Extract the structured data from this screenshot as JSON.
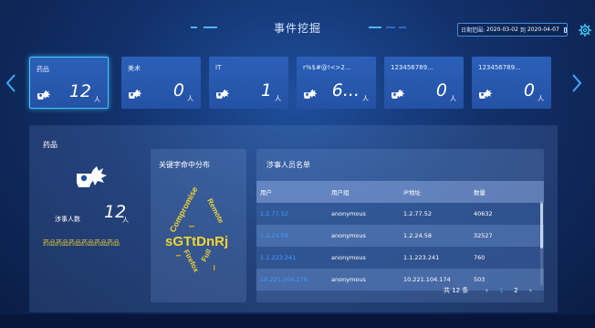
{
  "header": {
    "title": "事件挖掘",
    "date_label": "日期范围:",
    "date_start": "2020-03-02",
    "date_sep": "到",
    "date_end": "2020-04-07"
  },
  "cards": [
    {
      "label": "药品",
      "count": "12",
      "unit": "人"
    },
    {
      "label": "美术",
      "count": "0",
      "unit": "人"
    },
    {
      "label": "IT",
      "count": "1",
      "unit": "人"
    },
    {
      "label": "r%$#@!<>2...",
      "count": "6...",
      "unit": "人"
    },
    {
      "label": "123456789...",
      "count": "0",
      "unit": "人"
    },
    {
      "label": "123456789...",
      "count": "0",
      "unit": "人"
    }
  ],
  "detail": {
    "title": "药品",
    "people_label": "涉事人数",
    "people_count": "12",
    "people_unit": "人",
    "keyword_text": "药品药品药品药品药品药品"
  },
  "keywords": {
    "title": "关键字命中分布",
    "words": [
      {
        "text": "sGTtDnRj"
      },
      {
        "text": "Compromise"
      },
      {
        "text": "Remote"
      },
      {
        "text": "Firefox"
      },
      {
        "text": "Full"
      }
    ],
    "colors": {
      "primary": "#f2d434",
      "secondary": "#e6c52c"
    }
  },
  "table": {
    "title": "涉事人员名单",
    "columns": [
      "用户",
      "用户组",
      "IP地址",
      "数量"
    ],
    "rows": [
      [
        "1.2.77.52",
        "anonymous",
        "1.2.77.52",
        "40632"
      ],
      [
        "1.2.24.58",
        "anonymous",
        "1.2.24.58",
        "32527"
      ],
      [
        "1.1.223.241",
        "anonymous",
        "1.1.223.241",
        "760"
      ],
      [
        "10.221.104.174",
        "anonymous",
        "10.221.104.174",
        "503"
      ]
    ]
  },
  "pager": {
    "total": "共 12 条",
    "prev": "‹",
    "pages": [
      "1",
      "2"
    ],
    "current": "1",
    "next": "›"
  },
  "colors": {
    "accent": "#43c7ff",
    "link": "#3fa0ff",
    "card_bg": "#2452a5",
    "highlight_text": "#f2d434"
  }
}
